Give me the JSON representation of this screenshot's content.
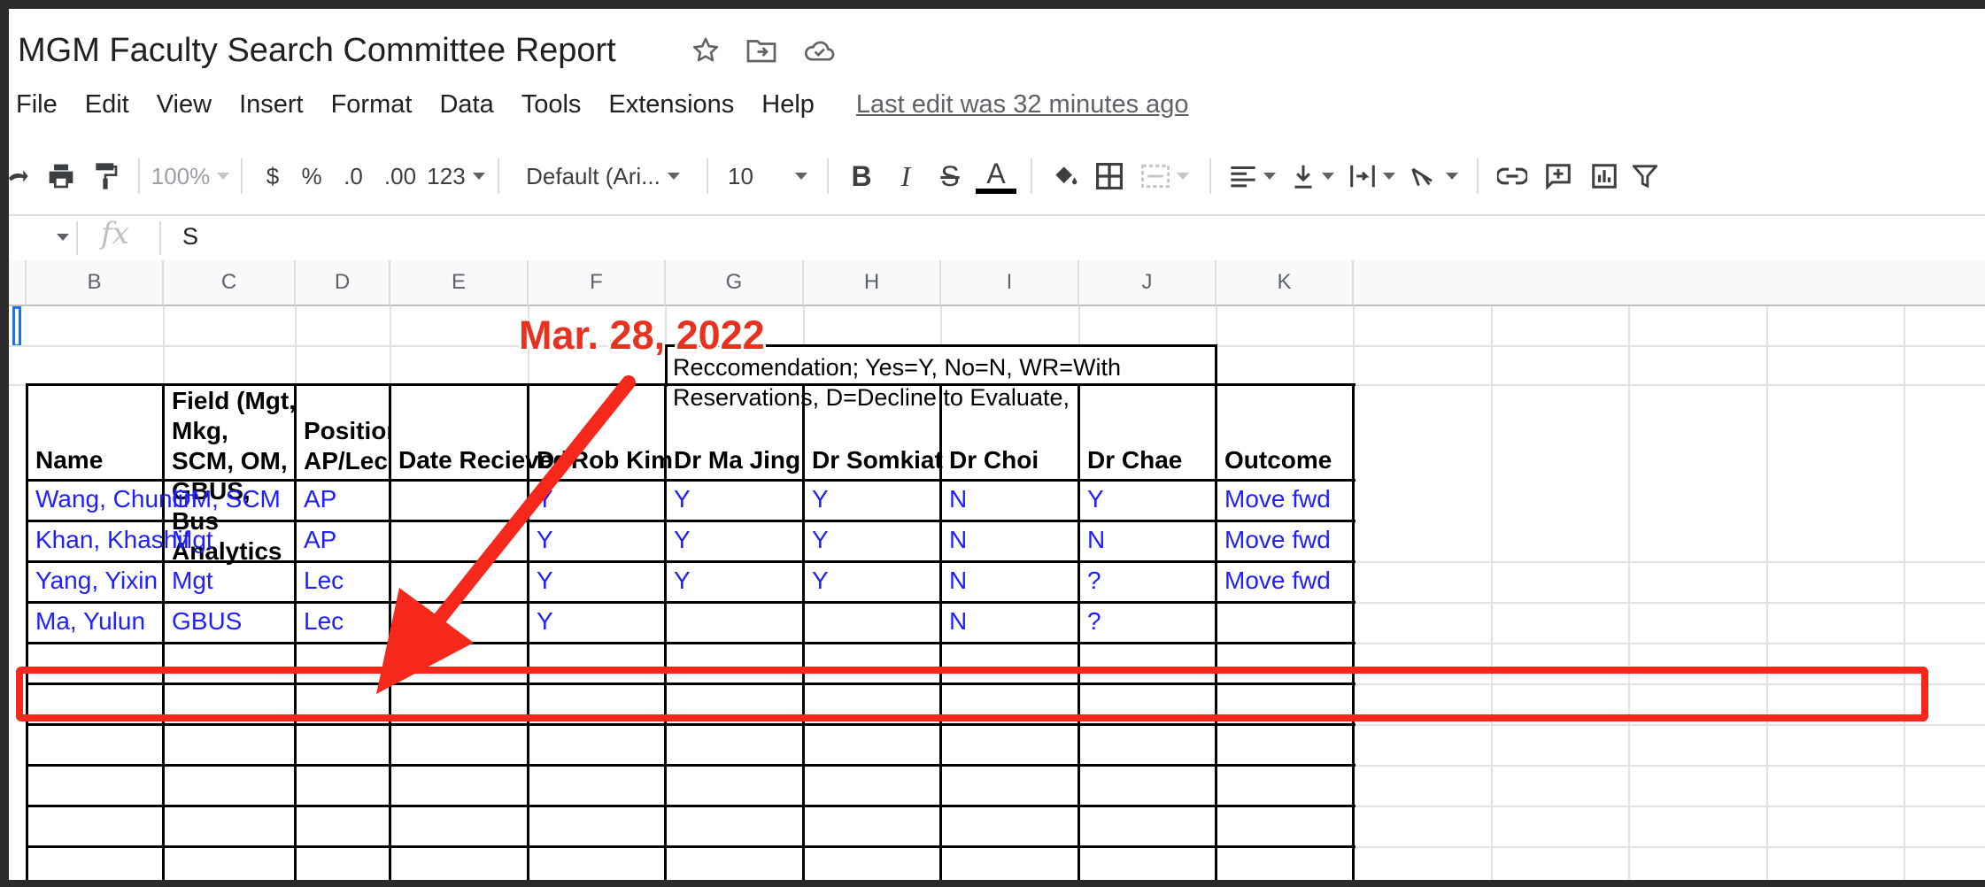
{
  "document": {
    "title": "MGM Faculty Search Committee Report",
    "title_icons": [
      "star-icon",
      "move-to-folder-icon",
      "cloud-saved-icon"
    ]
  },
  "menu": {
    "items": [
      "File",
      "Edit",
      "View",
      "Insert",
      "Format",
      "Data",
      "Tools",
      "Extensions",
      "Help"
    ],
    "last_edit": "Last edit was 32 minutes ago"
  },
  "toolbar": {
    "zoom": "100%",
    "currency": "$",
    "percent": "%",
    "decrease_decimal": ".0",
    "increase_decimal": ".00",
    "more_formats": "123",
    "font": "Default (Ari...",
    "font_size": "10",
    "bold": "B",
    "italic": "I",
    "strikethrough": "S",
    "text_color": "A",
    "icons": [
      "redo-icon",
      "print-icon",
      "paint-format-icon",
      "fill-color-icon",
      "borders-icon",
      "merge-cells-icon",
      "horizontal-align-icon",
      "vertical-align-icon",
      "text-wrap-icon",
      "text-rotation-icon",
      "insert-link-icon",
      "insert-comment-icon",
      "insert-chart-icon",
      "filter-icon"
    ]
  },
  "formula_bar": {
    "fx": "fx",
    "value": "S"
  },
  "grid": {
    "columns": [
      "B",
      "C",
      "D",
      "E",
      "F",
      "G",
      "H",
      "I",
      "J",
      "K"
    ],
    "note": "Reccomendation;  Yes=Y, No=N, WR=With Reservations, D=Decline to Evaluate,",
    "headers": {
      "name": "Name",
      "field": "Field (Mgt, Mkg, SCM, OM, GBUS, Bus Analytics",
      "position": "Position AP/Lec",
      "date_received": "Date Recieved",
      "kim": "Dr Rob Kim",
      "ma": "Dr Ma Jing",
      "somkiat": "Dr Somkiat",
      "choi": "Dr Choi",
      "chae": "Dr Chae",
      "outcome": "Outcome"
    },
    "rows": [
      {
        "name": "Wang, Chunlin",
        "field": "OM, SCM",
        "position": "AP",
        "date": "",
        "kim": "Y",
        "ma": "Y",
        "somkiat": "Y",
        "choi": "N",
        "chae": "Y",
        "outcome": "Move fwd"
      },
      {
        "name": "Khan, Khashif",
        "field": "Mgt",
        "position": "AP",
        "date": "",
        "kim": "Y",
        "ma": "Y",
        "somkiat": "Y",
        "choi": "N",
        "chae": "N",
        "outcome": "Move fwd"
      },
      {
        "name": "Yang, Yixin",
        "field": "Mgt",
        "position": "Lec",
        "date": "",
        "kim": "Y",
        "ma": "Y",
        "somkiat": "Y",
        "choi": "N",
        "chae": "?",
        "outcome": "Move fwd"
      },
      {
        "name": "Ma, Yulun",
        "field": "GBUS",
        "position": "Lec",
        "date": "",
        "kim": "Y",
        "ma": "",
        "somkiat": "",
        "choi": "N",
        "chae": "?",
        "outcome": ""
      }
    ]
  },
  "annotation": {
    "date_label": "Mar. 28, 2022",
    "accent_color": "#f6281b"
  },
  "colors": {
    "cell_text": "#1f1fff",
    "header_bg": "#f8f9fa"
  }
}
